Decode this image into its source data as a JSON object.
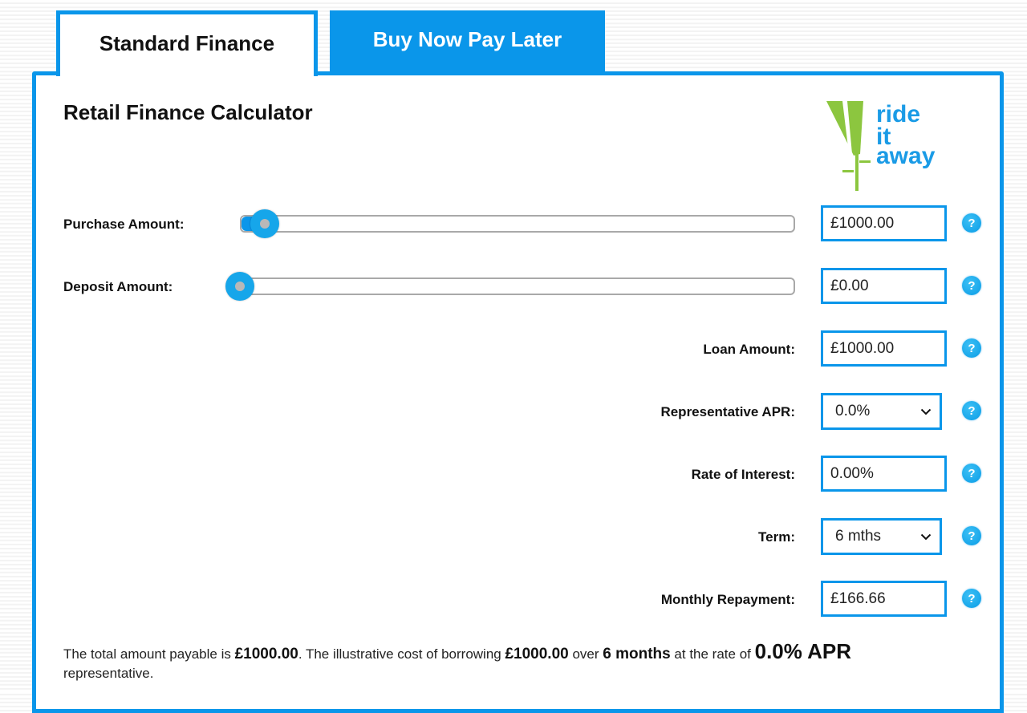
{
  "tabs": [
    {
      "label": "Standard Finance",
      "active": true
    },
    {
      "label": "Buy Now Pay Later",
      "active": false
    }
  ],
  "title": "Retail Finance Calculator",
  "logo": {
    "lines": [
      "ride",
      "it",
      "away"
    ],
    "colors": {
      "green": "#8cc63f",
      "blue": "#1a9be6"
    }
  },
  "accent_color": "#0a96ea",
  "purchase": {
    "label": "Purchase Amount:",
    "value": "£1000.00",
    "slider_fraction": 0.045
  },
  "deposit": {
    "label": "Deposit Amount:",
    "value": "£0.00",
    "slider_fraction": 0.0
  },
  "loan": {
    "label": "Loan Amount:",
    "value": "£1000.00"
  },
  "apr": {
    "label": "Representative APR:",
    "selected": "0.0%"
  },
  "interest": {
    "label": "Rate of Interest:",
    "value": "0.00%"
  },
  "term": {
    "label": "Term:",
    "selected": "6 mths"
  },
  "monthly": {
    "label": "Monthly Repayment:",
    "value": "£166.66"
  },
  "help_glyph": "?",
  "summary": {
    "t1": "The total amount payable is ",
    "total": "£1000.00",
    "t2": ". The illustrative cost of borrowing ",
    "borrow": "£1000.00",
    "t3": " over ",
    "term": "6 months",
    "t4": " at the rate of ",
    "apr": "0.0% APR",
    "t5": " representative."
  }
}
